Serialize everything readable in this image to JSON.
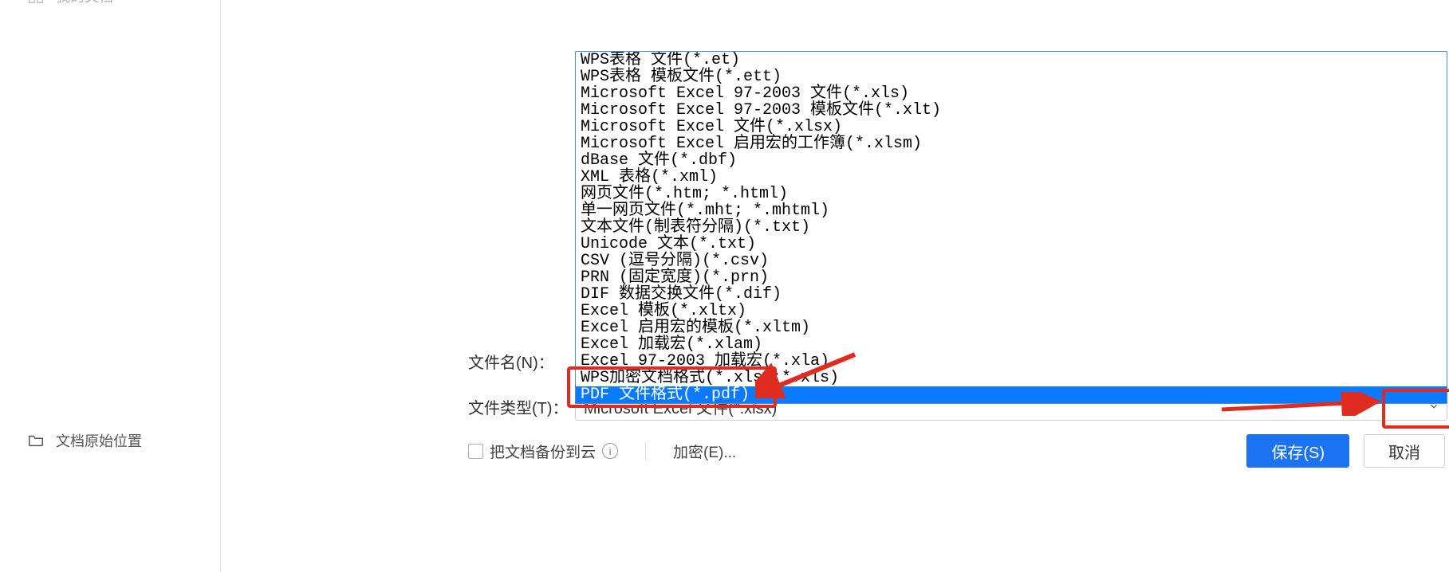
{
  "sidebar": {
    "items": [
      {
        "icon": "grid-icon",
        "label": "我的文档"
      },
      {
        "icon": "folder-icon",
        "label": "文档原始位置"
      }
    ]
  },
  "filetype_options": [
    "WPS表格 文件(*.et)",
    "WPS表格 模板文件(*.ett)",
    "Microsoft Excel 97-2003 文件(*.xls)",
    "Microsoft Excel 97-2003 模板文件(*.xlt)",
    "Microsoft Excel 文件(*.xlsx)",
    "Microsoft Excel 启用宏的工作簿(*.xlsm)",
    "dBase 文件(*.dbf)",
    "XML 表格(*.xml)",
    "网页文件(*.htm; *.html)",
    "单一网页文件(*.mht; *.mhtml)",
    "文本文件(制表符分隔)(*.txt)",
    "Unicode 文本(*.txt)",
    "CSV (逗号分隔)(*.csv)",
    "PRN (固定宽度)(*.prn)",
    "DIF 数据交换文件(*.dif)",
    "Excel 模板(*.xltx)",
    "Excel 启用宏的模板(*.xltm)",
    "Excel 加载宏(*.xlam)",
    "Excel 97-2003 加载宏(*.xla)",
    "WPS加密文档格式(*.xlsx;*.xls)",
    "PDF 文件格式(*.pdf)"
  ],
  "selected_option_index": 20,
  "labels": {
    "filename": "文件名(N)：",
    "filetype": "文件类型(T)：",
    "backup": "把文档备份到云",
    "encrypt": "加密(E)...",
    "save": "保存(S)",
    "cancel": "取消"
  },
  "filetype_current": "Microsoft Excel 文件(*.xlsx)"
}
